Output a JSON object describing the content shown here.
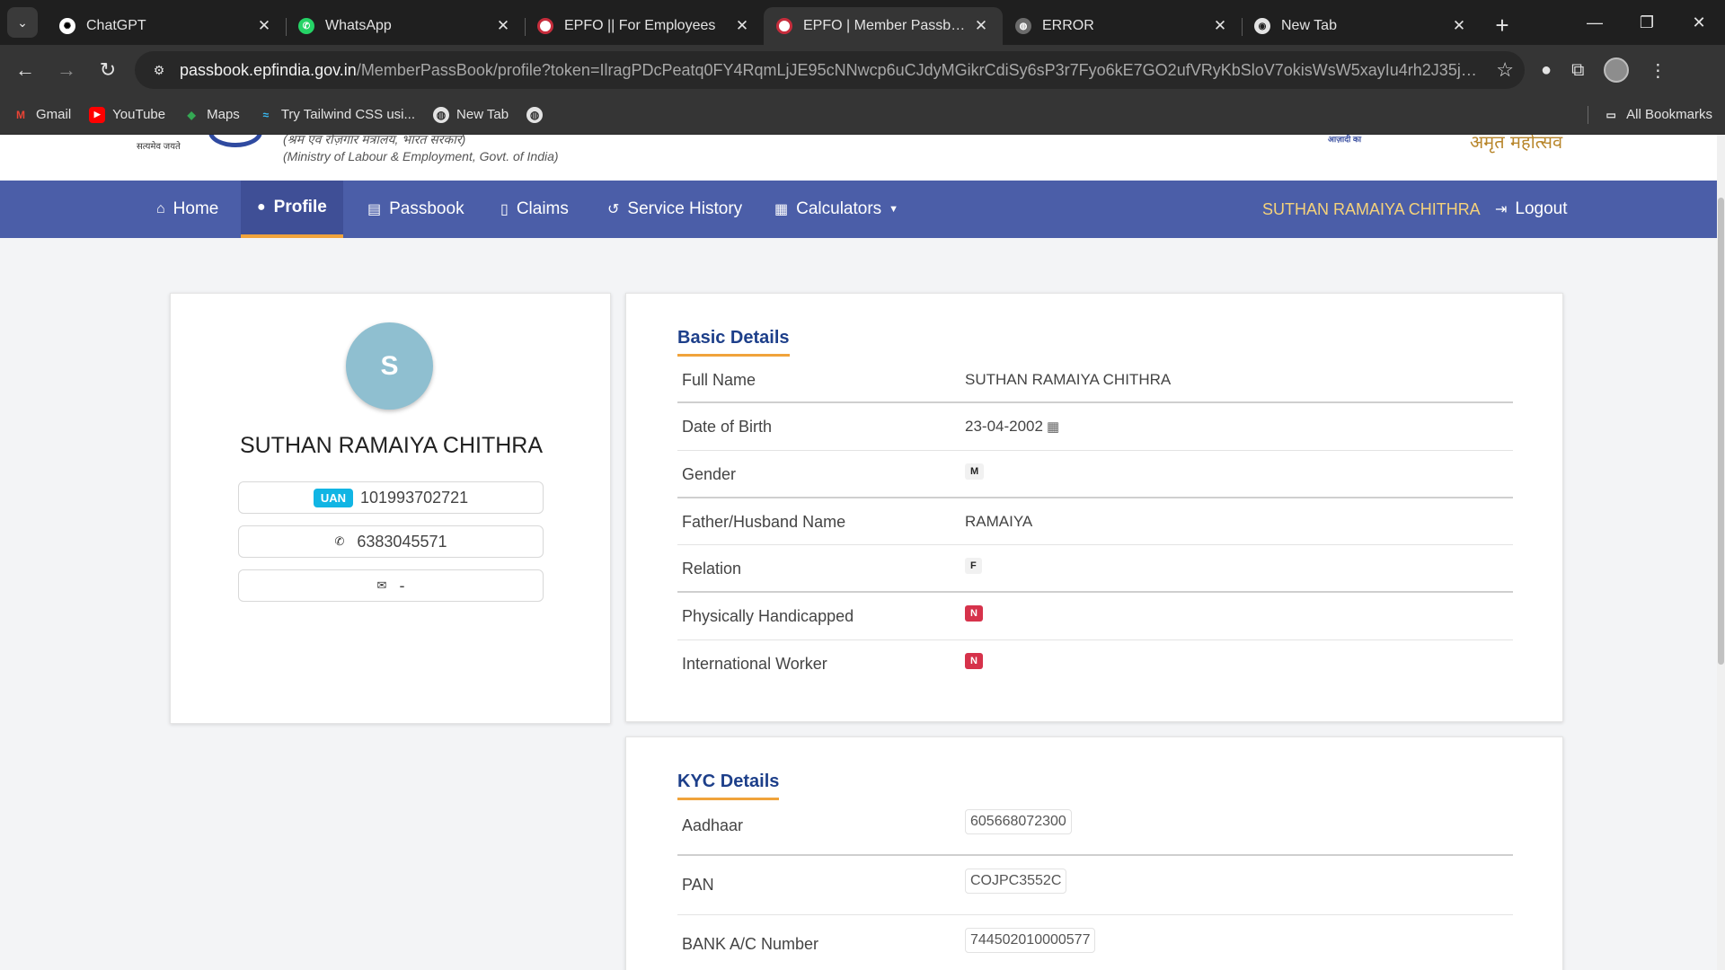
{
  "browser": {
    "tabs": [
      {
        "title": "ChatGPT",
        "favicon": "chatgpt-icon",
        "active": false
      },
      {
        "title": "WhatsApp",
        "favicon": "whatsapp-icon",
        "active": false
      },
      {
        "title": "EPFO || For Employees",
        "favicon": "epfo-icon",
        "active": false
      },
      {
        "title": "EPFO | Member Passbook |",
        "favicon": "epfo-icon",
        "active": true
      },
      {
        "title": "ERROR",
        "favicon": "globe-icon",
        "active": false
      },
      {
        "title": "New Tab",
        "favicon": "chrome-icon",
        "active": false
      }
    ],
    "url_host": "passbook.epfindia.gov.in",
    "url_path": "/MemberPassBook/profile?token=IlragPDcPeatq0FY4RqmLjJE95cNNwcp6uCJdyMGikrCdiSy6sP3r7Fyo6kE7GO2ufVRyKbSloV7okisWsW5xayIu4rh2J35jUdmqTgibinr...",
    "bookmarks": [
      {
        "label": "Gmail",
        "icon": "gmail-icon"
      },
      {
        "label": "YouTube",
        "icon": "youtube-icon"
      },
      {
        "label": "Maps",
        "icon": "maps-icon"
      },
      {
        "label": "Try Tailwind CSS usi...",
        "icon": "tailwind-icon"
      },
      {
        "label": "New Tab",
        "icon": "globe-icon"
      },
      {
        "label": "",
        "icon": "globe-icon"
      }
    ],
    "all_bookmarks": "All Bookmarks"
  },
  "header": {
    "emblem_text": "सत्यमेव जयते",
    "ministry_hindi": "(श्रम एवं रोज़गार मंत्रालय, भारत सरकार)",
    "ministry_english": "(Ministry of Labour & Employment, Govt. of India)",
    "azadi_text": "आज़ादी का",
    "amrit_text": "अमृत महोत्सव"
  },
  "nav": {
    "items": [
      {
        "label": "Home",
        "icon": "home-icon"
      },
      {
        "label": "Profile",
        "icon": "user-icon"
      },
      {
        "label": "Passbook",
        "icon": "passbook-icon"
      },
      {
        "label": "Claims",
        "icon": "document-icon"
      },
      {
        "label": "Service History",
        "icon": "history-icon"
      },
      {
        "label": "Calculators",
        "icon": "calculator-icon"
      }
    ],
    "user_name": "SUTHAN RAMAIYA CHITHRA",
    "logout": "Logout"
  },
  "profile": {
    "avatar_initial": "S",
    "name": "SUTHAN RAMAIYA CHITHRA",
    "uan_badge": "UAN",
    "uan": "101993702721",
    "phone": "6383045571",
    "email": "-"
  },
  "basic_details": {
    "title": "Basic Details",
    "rows": [
      {
        "label": "Full Name",
        "value": "SUTHAN RAMAIYA CHITHRA"
      },
      {
        "label": "Date of Birth",
        "value": "23-04-2002"
      },
      {
        "label": "Gender",
        "value": "M"
      },
      {
        "label": "Father/Husband Name",
        "value": "RAMAIYA"
      },
      {
        "label": "Relation",
        "value": "F"
      },
      {
        "label": "Physically Handicapped",
        "value": "N"
      },
      {
        "label": "International Worker",
        "value": "N"
      }
    ]
  },
  "kyc_details": {
    "title": "KYC Details",
    "rows": [
      {
        "label": "Aadhaar",
        "value": "605668072300"
      },
      {
        "label": "PAN",
        "value": "COJPC3552C"
      },
      {
        "label": "BANK A/C Number",
        "value": "744502010000577"
      }
    ]
  },
  "colors": {
    "nav_bg": "#4b5ea8",
    "accent_orange": "#f0a33b",
    "title_blue": "#1d3f8a",
    "uan_badge": "#11b5e4",
    "no_badge_red": "#d6324b"
  }
}
